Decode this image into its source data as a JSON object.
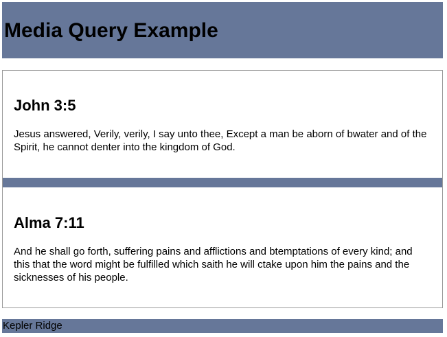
{
  "header": {
    "title": "Media Query Example"
  },
  "articles": [
    {
      "heading": "John 3:5",
      "text": "Jesus answered, Verily, verily, I say unto thee, Except a man be aborn of bwater and of the Spirit, he cannot denter into the kingdom of God."
    },
    {
      "heading": "Alma 7:11",
      "text": "And he shall go forth, suffering pains and afflictions and btemptations of every kind; and this that the word might be fulfilled which saith he will ctake upon him the pains and the sicknesses of his people."
    }
  ],
  "footer": {
    "text": "Kepler Ridge"
  },
  "colors": {
    "band": "#667799",
    "border": "#9a9a9a",
    "background": "#ffffff"
  }
}
